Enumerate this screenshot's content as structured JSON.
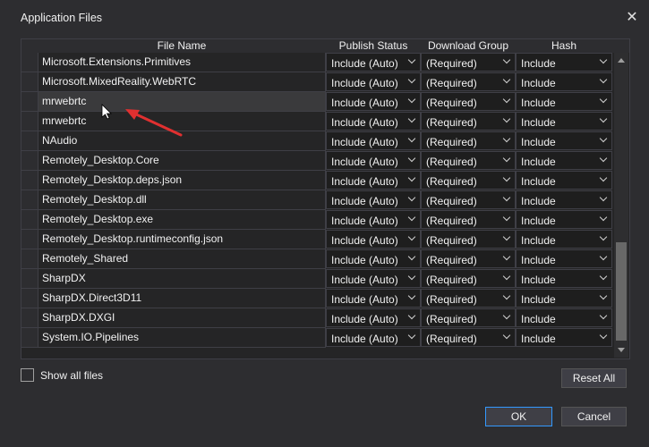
{
  "window": {
    "title": "Application Files"
  },
  "columns": {
    "file_name": "File Name",
    "publish_status": "Publish Status",
    "download_group": "Download Group",
    "hash": "Hash"
  },
  "rows": [
    {
      "file": "Microsoft.Extensions.Primitives",
      "status": "Include (Auto)",
      "group": "(Required)",
      "hash": "Include"
    },
    {
      "file": "Microsoft.MixedReality.WebRTC",
      "status": "Include (Auto)",
      "group": "(Required)",
      "hash": "Include"
    },
    {
      "file": "mrwebrtc",
      "status": "Include (Auto)",
      "group": "(Required)",
      "hash": "Include"
    },
    {
      "file": "mrwebrtc",
      "status": "Include (Auto)",
      "group": "(Required)",
      "hash": "Include"
    },
    {
      "file": "NAudio",
      "status": "Include (Auto)",
      "group": "(Required)",
      "hash": "Include"
    },
    {
      "file": "Remotely_Desktop.Core",
      "status": "Include (Auto)",
      "group": "(Required)",
      "hash": "Include"
    },
    {
      "file": "Remotely_Desktop.deps.json",
      "status": "Include (Auto)",
      "group": "(Required)",
      "hash": "Include"
    },
    {
      "file": "Remotely_Desktop.dll",
      "status": "Include (Auto)",
      "group": "(Required)",
      "hash": "Include"
    },
    {
      "file": "Remotely_Desktop.exe",
      "status": "Include (Auto)",
      "group": "(Required)",
      "hash": "Include"
    },
    {
      "file": "Remotely_Desktop.runtimeconfig.json",
      "status": "Include (Auto)",
      "group": "(Required)",
      "hash": "Include"
    },
    {
      "file": "Remotely_Shared",
      "status": "Include (Auto)",
      "group": "(Required)",
      "hash": "Include"
    },
    {
      "file": "SharpDX",
      "status": "Include (Auto)",
      "group": "(Required)",
      "hash": "Include"
    },
    {
      "file": "SharpDX.Direct3D11",
      "status": "Include (Auto)",
      "group": "(Required)",
      "hash": "Include"
    },
    {
      "file": "SharpDX.DXGI",
      "status": "Include (Auto)",
      "group": "(Required)",
      "hash": "Include"
    },
    {
      "file": "System.IO.Pipelines",
      "status": "Include (Auto)",
      "group": "(Required)",
      "hash": "Include"
    }
  ],
  "footer": {
    "show_all_label": "Show all files",
    "reset_all": "Reset All",
    "ok": "OK",
    "cancel": "Cancel"
  },
  "colors": {
    "background": "#2d2d30",
    "grid": "#252526",
    "accent": "#3399ff",
    "arrow": "#e03030"
  }
}
